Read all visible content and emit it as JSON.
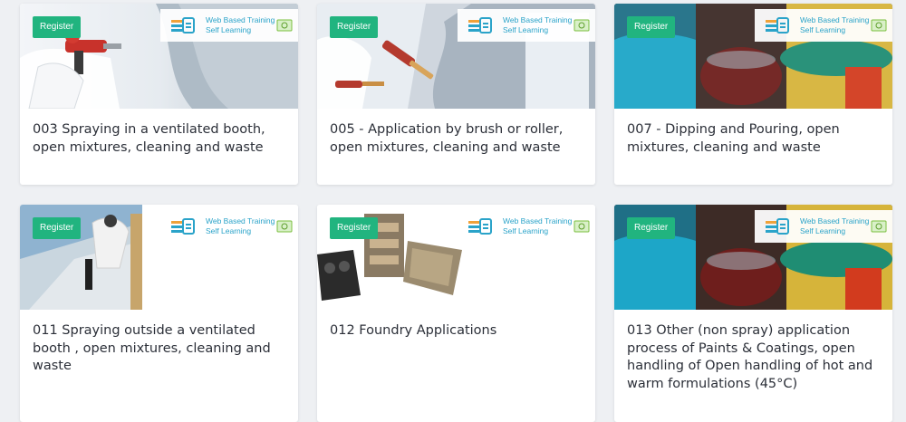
{
  "register_label": "Register",
  "training_tag": {
    "line1": "Web Based Training",
    "line2": "Self Learning"
  },
  "cards": [
    {
      "id": "003",
      "title": "003 Spraying in a ventilated booth, open mixtures, cleaning and waste",
      "image": "spray-gun-booth"
    },
    {
      "id": "005",
      "title": "005 - Application by brush or roller, open mixtures, cleaning and waste",
      "image": "brush-roller"
    },
    {
      "id": "007",
      "title": "007 - Dipping and Pouring, open mixtures, cleaning and waste",
      "image": "lab-glassware"
    },
    {
      "id": "011",
      "title": "011 Spraying outside a ventilated booth , open mixtures, cleaning and waste",
      "image": "spray-outdoor-wall"
    },
    {
      "id": "012",
      "title": "012 Foundry Applications",
      "image": "foundry-castings"
    },
    {
      "id": "013",
      "title": "013 Other (non spray) application process of Paints & Coatings, open handling of Open handling of hot and warm formulations (45°C)",
      "image": "lab-glassware"
    }
  ],
  "colors": {
    "accent": "#21b47f",
    "tag_text": "#2aa3c9",
    "title_text": "#2b2f38"
  }
}
